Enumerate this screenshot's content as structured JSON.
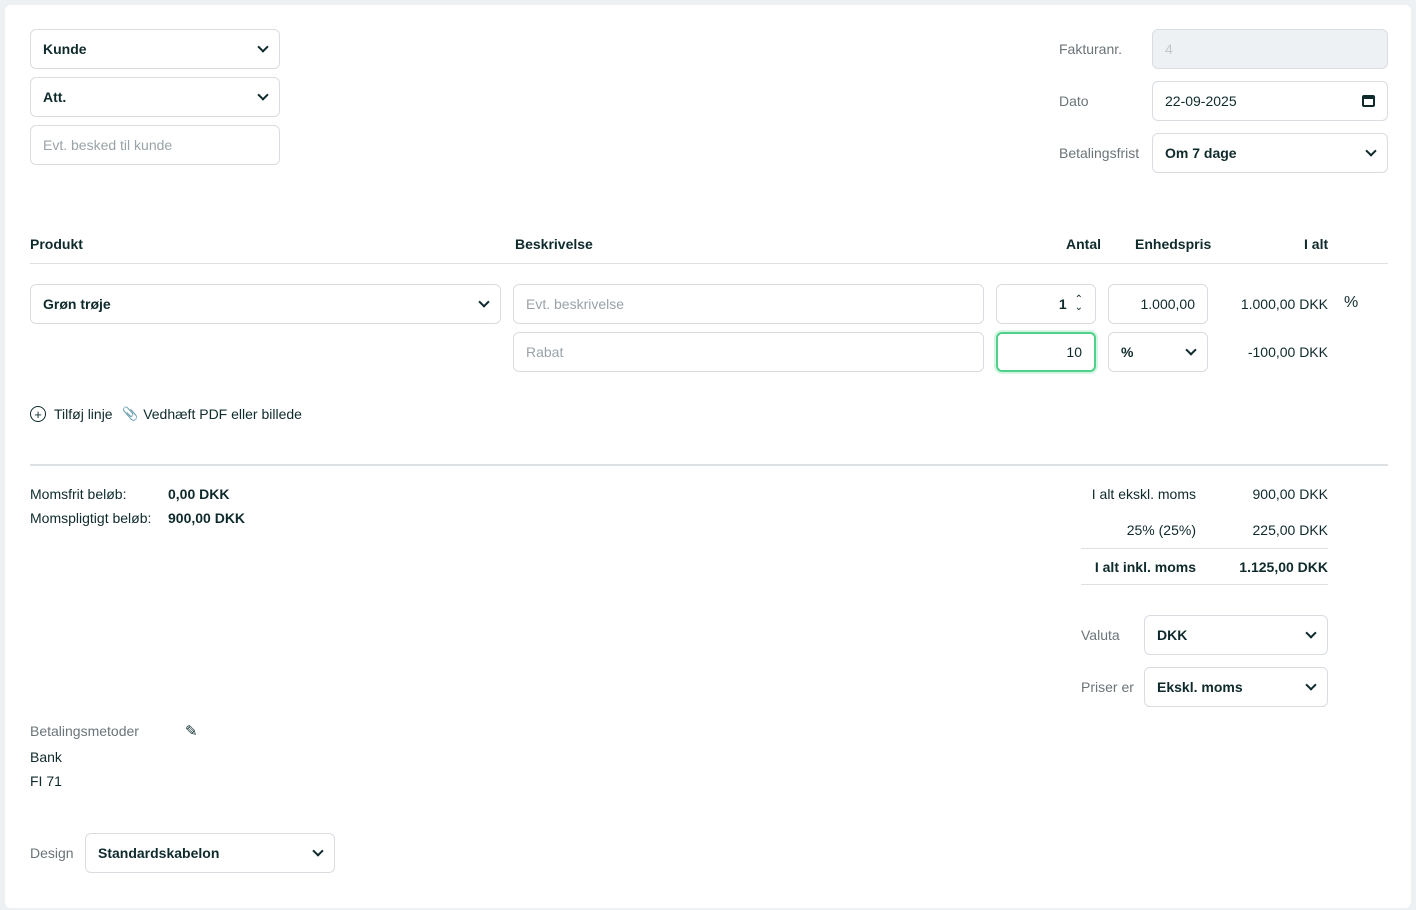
{
  "customer": {
    "kunde": "Kunde",
    "att": "Att.",
    "message_placeholder": "Evt. besked til kunde"
  },
  "meta": {
    "invoice_no_label": "Fakturanr.",
    "invoice_no": "4",
    "date_label": "Dato",
    "date": "22-09-2025",
    "due_label": "Betalingsfrist",
    "due": "Om 7 dage"
  },
  "table": {
    "headers": [
      "Produkt",
      "Beskrivelse",
      "Antal",
      "Enhedspris",
      "I alt"
    ],
    "line": {
      "product": "Grøn trøje",
      "desc_placeholder": "Evt. beskrivelse",
      "qty": "1",
      "unit_price": "1.000,00",
      "total": "1.000,00 DKK",
      "discount_toggle": "%"
    },
    "discount": {
      "placeholder": "Rabat",
      "value": "10",
      "type": "%",
      "total": "-100,00 DKK"
    }
  },
  "actions": {
    "add_line": "Tilføj linje",
    "attach": "Vedhæft PDF eller billede"
  },
  "summary": {
    "vat_free_label": "Momsfrit beløb:",
    "vat_free": "0,00 DKK",
    "vat_liable_label": "Momspligtigt beløb:",
    "vat_liable": "900,00 DKK",
    "excl_label": "I alt ekskl. moms",
    "excl": "900,00 DKK",
    "vat_label": "25% (25%)",
    "vat": "225,00 DKK",
    "incl_label": "I alt inkl. moms",
    "incl": "1.125,00 DKK"
  },
  "currency": {
    "label": "Valuta",
    "value": "DKK"
  },
  "prices": {
    "label": "Priser er",
    "value": "Ekskl. moms"
  },
  "payment": {
    "label": "Betalingsmetoder",
    "method": "Bank",
    "code": "FI 71"
  },
  "design": {
    "label": "Design",
    "value": "Standardskabelon"
  }
}
